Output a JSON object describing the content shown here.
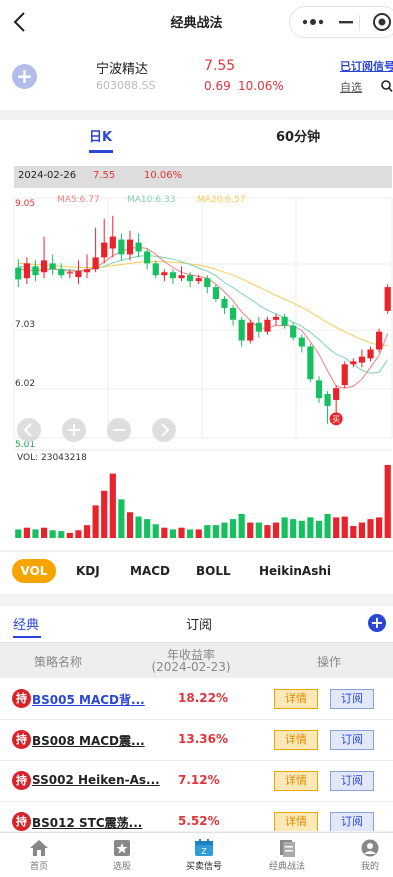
{
  "header": {
    "title": "经典战法"
  },
  "stock": {
    "name": "宁波精达",
    "code": "603088.SS",
    "price": "7.55",
    "change": "0.69",
    "change_pct": "10.06%",
    "subscribed_label": "已订阅信号",
    "self_select_label": "自选"
  },
  "chart_tabs": {
    "day": "日K",
    "min60": "60分钟"
  },
  "chart_info": {
    "date": "2024-02-26",
    "price": "7.55",
    "pct": "10.06%"
  },
  "ma_labels": {
    "ma5": "MA5:6.77",
    "ma10": "MA10:6.33",
    "ma20": "MA20:6.57"
  },
  "axis": {
    "top": "9.05",
    "mid1": "7.03",
    "mid2": "6.02",
    "bottom": "5.01"
  },
  "vol_label": "VOL: 23043218",
  "buy_mark": "买",
  "colors": {
    "up": "#e8232c",
    "down": "#16c060",
    "ma5": "#f08080",
    "ma10": "#7fd3b3",
    "ma20": "#f5cc55",
    "accent": "#2a46d6",
    "active_tab": "#f5a400"
  },
  "chart_data": {
    "type": "candlestick",
    "ylim": [
      5.01,
      9.05
    ],
    "candles": [
      {
        "o": 7.88,
        "c": 7.68,
        "h": 8.02,
        "l": 7.55
      },
      {
        "o": 7.7,
        "c": 7.95,
        "h": 8.05,
        "l": 7.6
      },
      {
        "o": 7.9,
        "c": 7.75,
        "h": 8.0,
        "l": 7.65
      },
      {
        "o": 7.8,
        "c": 8.0,
        "h": 8.4,
        "l": 7.7
      },
      {
        "o": 7.95,
        "c": 7.85,
        "h": 8.1,
        "l": 7.75
      },
      {
        "o": 7.85,
        "c": 7.75,
        "h": 7.95,
        "l": 7.7
      },
      {
        "o": 7.78,
        "c": 7.8,
        "h": 7.85,
        "l": 7.7
      },
      {
        "o": 7.72,
        "c": 7.82,
        "h": 8.0,
        "l": 7.6
      },
      {
        "o": 7.8,
        "c": 7.85,
        "h": 8.1,
        "l": 7.7
      },
      {
        "o": 7.85,
        "c": 8.05,
        "h": 8.55,
        "l": 7.8
      },
      {
        "o": 8.05,
        "c": 8.3,
        "h": 8.7,
        "l": 7.95
      },
      {
        "o": 8.2,
        "c": 8.4,
        "h": 8.75,
        "l": 8.05
      },
      {
        "o": 8.35,
        "c": 8.1,
        "h": 8.45,
        "l": 8.0
      },
      {
        "o": 8.1,
        "c": 8.35,
        "h": 8.5,
        "l": 8.0
      },
      {
        "o": 8.3,
        "c": 8.15,
        "h": 8.45,
        "l": 8.05
      },
      {
        "o": 8.15,
        "c": 7.95,
        "h": 8.2,
        "l": 7.85
      },
      {
        "o": 7.95,
        "c": 7.75,
        "h": 8.0,
        "l": 7.7
      },
      {
        "o": 7.75,
        "c": 7.8,
        "h": 7.85,
        "l": 7.65
      },
      {
        "o": 7.8,
        "c": 7.7,
        "h": 7.85,
        "l": 7.6
      },
      {
        "o": 7.7,
        "c": 7.75,
        "h": 7.9,
        "l": 7.65
      },
      {
        "o": 7.75,
        "c": 7.65,
        "h": 7.8,
        "l": 7.55
      },
      {
        "o": 7.65,
        "c": 7.7,
        "h": 7.75,
        "l": 7.6
      },
      {
        "o": 7.7,
        "c": 7.55,
        "h": 7.75,
        "l": 7.45
      },
      {
        "o": 7.55,
        "c": 7.35,
        "h": 7.6,
        "l": 7.3
      },
      {
        "o": 7.35,
        "c": 7.2,
        "h": 7.4,
        "l": 7.1
      },
      {
        "o": 7.2,
        "c": 7.0,
        "h": 7.25,
        "l": 6.9
      },
      {
        "o": 7.0,
        "c": 6.65,
        "h": 7.05,
        "l": 6.55
      },
      {
        "o": 6.65,
        "c": 6.95,
        "h": 7.0,
        "l": 6.6
      },
      {
        "o": 6.95,
        "c": 6.8,
        "h": 7.05,
        "l": 6.7
      },
      {
        "o": 6.8,
        "c": 7.0,
        "h": 7.05,
        "l": 6.75
      },
      {
        "o": 7.0,
        "c": 7.05,
        "h": 7.1,
        "l": 6.9
      },
      {
        "o": 7.05,
        "c": 6.9,
        "h": 7.1,
        "l": 6.85
      },
      {
        "o": 6.9,
        "c": 6.7,
        "h": 6.95,
        "l": 6.65
      },
      {
        "o": 6.7,
        "c": 6.55,
        "h": 6.75,
        "l": 6.45
      },
      {
        "o": 6.55,
        "c": 6.0,
        "h": 6.6,
        "l": 5.95
      },
      {
        "o": 5.98,
        "c": 5.68,
        "h": 6.05,
        "l": 5.6
      },
      {
        "o": 5.75,
        "c": 5.55,
        "h": 5.8,
        "l": 5.25
      },
      {
        "o": 5.65,
        "c": 5.85,
        "h": 5.9,
        "l": 5.4
      },
      {
        "o": 5.9,
        "c": 6.25,
        "h": 6.3,
        "l": 5.85
      },
      {
        "o": 6.25,
        "c": 6.3,
        "h": 6.35,
        "l": 6.2
      },
      {
        "o": 6.28,
        "c": 6.38,
        "h": 6.5,
        "l": 6.2
      },
      {
        "o": 6.35,
        "c": 6.5,
        "h": 6.55,
        "l": 6.3
      },
      {
        "o": 6.5,
        "c": 6.8,
        "h": 6.85,
        "l": 6.45
      },
      {
        "o": 7.15,
        "c": 7.55,
        "h": 7.6,
        "l": 7.1
      }
    ],
    "volumes": [
      0.1,
      0.12,
      0.1,
      0.12,
      0.09,
      0.08,
      0.06,
      0.09,
      0.15,
      0.38,
      0.55,
      0.75,
      0.45,
      0.3,
      0.25,
      0.22,
      0.16,
      0.12,
      0.1,
      0.12,
      0.1,
      0.1,
      0.15,
      0.15,
      0.18,
      0.22,
      0.28,
      0.18,
      0.18,
      0.15,
      0.18,
      0.24,
      0.22,
      0.2,
      0.24,
      0.2,
      0.28,
      0.24,
      0.25,
      0.14,
      0.18,
      0.22,
      0.24,
      0.85
    ],
    "ma5": [
      7.85,
      7.84,
      7.82,
      7.84,
      7.86,
      7.83,
      7.82,
      7.82,
      7.84,
      7.88,
      7.97,
      8.08,
      8.15,
      8.2,
      8.22,
      8.2,
      8.1,
      7.98,
      7.88,
      7.8,
      7.76,
      7.73,
      7.7,
      7.6,
      7.47,
      7.32,
      7.13,
      6.99,
      6.87,
      6.85,
      6.91,
      6.9,
      6.9,
      6.82,
      6.63,
      6.42,
      6.14,
      5.88,
      5.85,
      5.88,
      6.0,
      6.2,
      6.4,
      6.77
    ],
    "ma10": [
      7.9,
      7.88,
      7.86,
      7.85,
      7.85,
      7.85,
      7.84,
      7.83,
      7.84,
      7.86,
      7.9,
      7.96,
      8.0,
      8.04,
      8.07,
      8.08,
      8.07,
      8.05,
      8.02,
      7.98,
      7.93,
      7.87,
      7.82,
      7.74,
      7.63,
      7.54,
      7.44,
      7.35,
      7.25,
      7.16,
      7.1,
      7.03,
      6.96,
      6.89,
      6.79,
      6.67,
      6.53,
      6.42,
      6.36,
      6.25,
      6.15,
      6.1,
      6.12,
      6.33
    ],
    "ma20": [
      7.95,
      7.94,
      7.93,
      7.92,
      7.91,
      7.9,
      7.89,
      7.88,
      7.88,
      7.88,
      7.89,
      7.91,
      7.93,
      7.95,
      7.97,
      7.98,
      7.98,
      7.98,
      7.97,
      7.96,
      7.94,
      7.92,
      7.89,
      7.85,
      7.8,
      7.75,
      7.69,
      7.62,
      7.55,
      7.48,
      7.41,
      7.35,
      7.28,
      7.21,
      7.13,
      7.04,
      6.95,
      6.87,
      6.8,
      6.73,
      6.67,
      6.61,
      6.57,
      6.57
    ]
  },
  "indicator_tabs": [
    "VOL",
    "KDJ",
    "MACD",
    "BOLL",
    "HeikinAshi"
  ],
  "list": {
    "tab_classic": "经典",
    "tab_sub": "订阅",
    "col_name": "策略名称",
    "col_ret": "年收益率",
    "col_ret_date": "(2024-02-23)",
    "col_op": "操作",
    "hold_label": "持",
    "detail_label": "详情",
    "sub_label": "订阅",
    "rows": [
      {
        "name": "BS005 MACD背...",
        "ret": "18.22%"
      },
      {
        "name": "BS008 MACD震...",
        "ret": "13.36%"
      },
      {
        "name": "SS002 Heiken-As...",
        "ret": "7.12%"
      },
      {
        "name": "BS012 STC震荡...",
        "ret": "5.52%"
      }
    ]
  },
  "nav": [
    "首页",
    "选股",
    "买卖信号",
    "经典战法",
    "我的"
  ]
}
